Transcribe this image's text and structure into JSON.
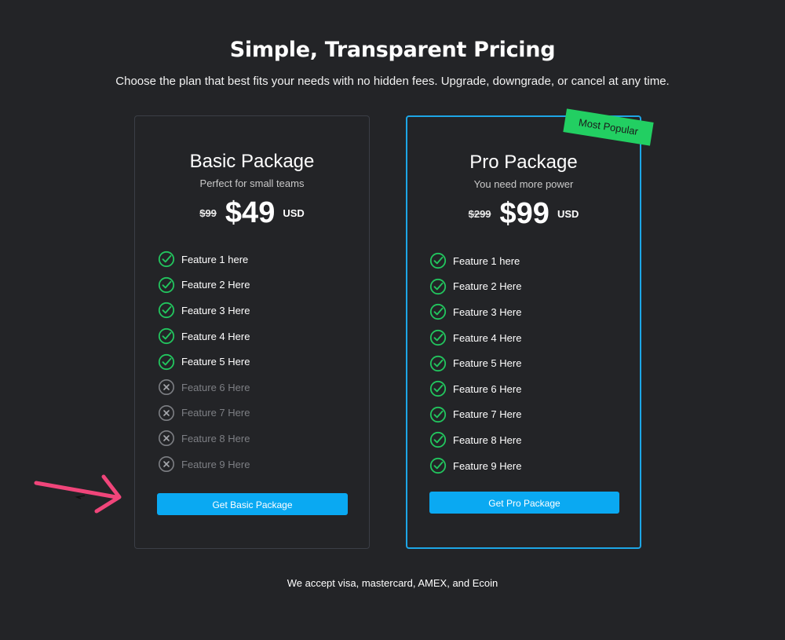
{
  "header": {
    "title": "Simple, Transparent Pricing",
    "subtitle": "Choose the plan that best fits your needs with no hidden fees. Upgrade, downgrade, or cancel at any time."
  },
  "plans": [
    {
      "name": "Basic Package",
      "description": "Perfect for small teams",
      "old_price": "$99",
      "price": "$49",
      "currency": "USD",
      "cta_label": "Get Basic Package",
      "features": [
        {
          "label": "Feature 1 here",
          "included": true
        },
        {
          "label": "Feature 2 Here",
          "included": true
        },
        {
          "label": "Feature 3 Here",
          "included": true
        },
        {
          "label": "Feature 4 Here",
          "included": true
        },
        {
          "label": "Feature 5 Here",
          "included": true
        },
        {
          "label": "Feature 6 Here",
          "included": false
        },
        {
          "label": "Feature 7 Here",
          "included": false
        },
        {
          "label": "Feature 8 Here",
          "included": false
        },
        {
          "label": "Feature 9 Here",
          "included": false
        }
      ]
    },
    {
      "name": "Pro Package",
      "description": "You need more power",
      "badge": "Most Popular",
      "old_price": "$299",
      "price": "$99",
      "currency": "USD",
      "cta_label": "Get Pro Package",
      "features": [
        {
          "label": "Feature 1 here",
          "included": true
        },
        {
          "label": "Feature 2 Here",
          "included": true
        },
        {
          "label": "Feature 3 Here",
          "included": true
        },
        {
          "label": "Feature 4 Here",
          "included": true
        },
        {
          "label": "Feature 5 Here",
          "included": true
        },
        {
          "label": "Feature 6 Here",
          "included": true
        },
        {
          "label": "Feature 7 Here",
          "included": true
        },
        {
          "label": "Feature 8 Here",
          "included": true
        },
        {
          "label": "Feature 9 Here",
          "included": true
        }
      ]
    }
  ],
  "footer": {
    "payment_note": "We accept visa, mastercard, AMEX, and Ecoin"
  },
  "icons": {
    "included": "check-circle-icon",
    "excluded": "x-circle-icon",
    "annotation": "arrow-annotation-icon"
  },
  "colors": {
    "background": "#232427",
    "accent": "#0aa9f2",
    "pro_border": "#1da6e6",
    "badge": "#22cf62",
    "check": "#22c55e",
    "excluded": "#7d7f84",
    "annotation_arrow": "#f0457a"
  }
}
